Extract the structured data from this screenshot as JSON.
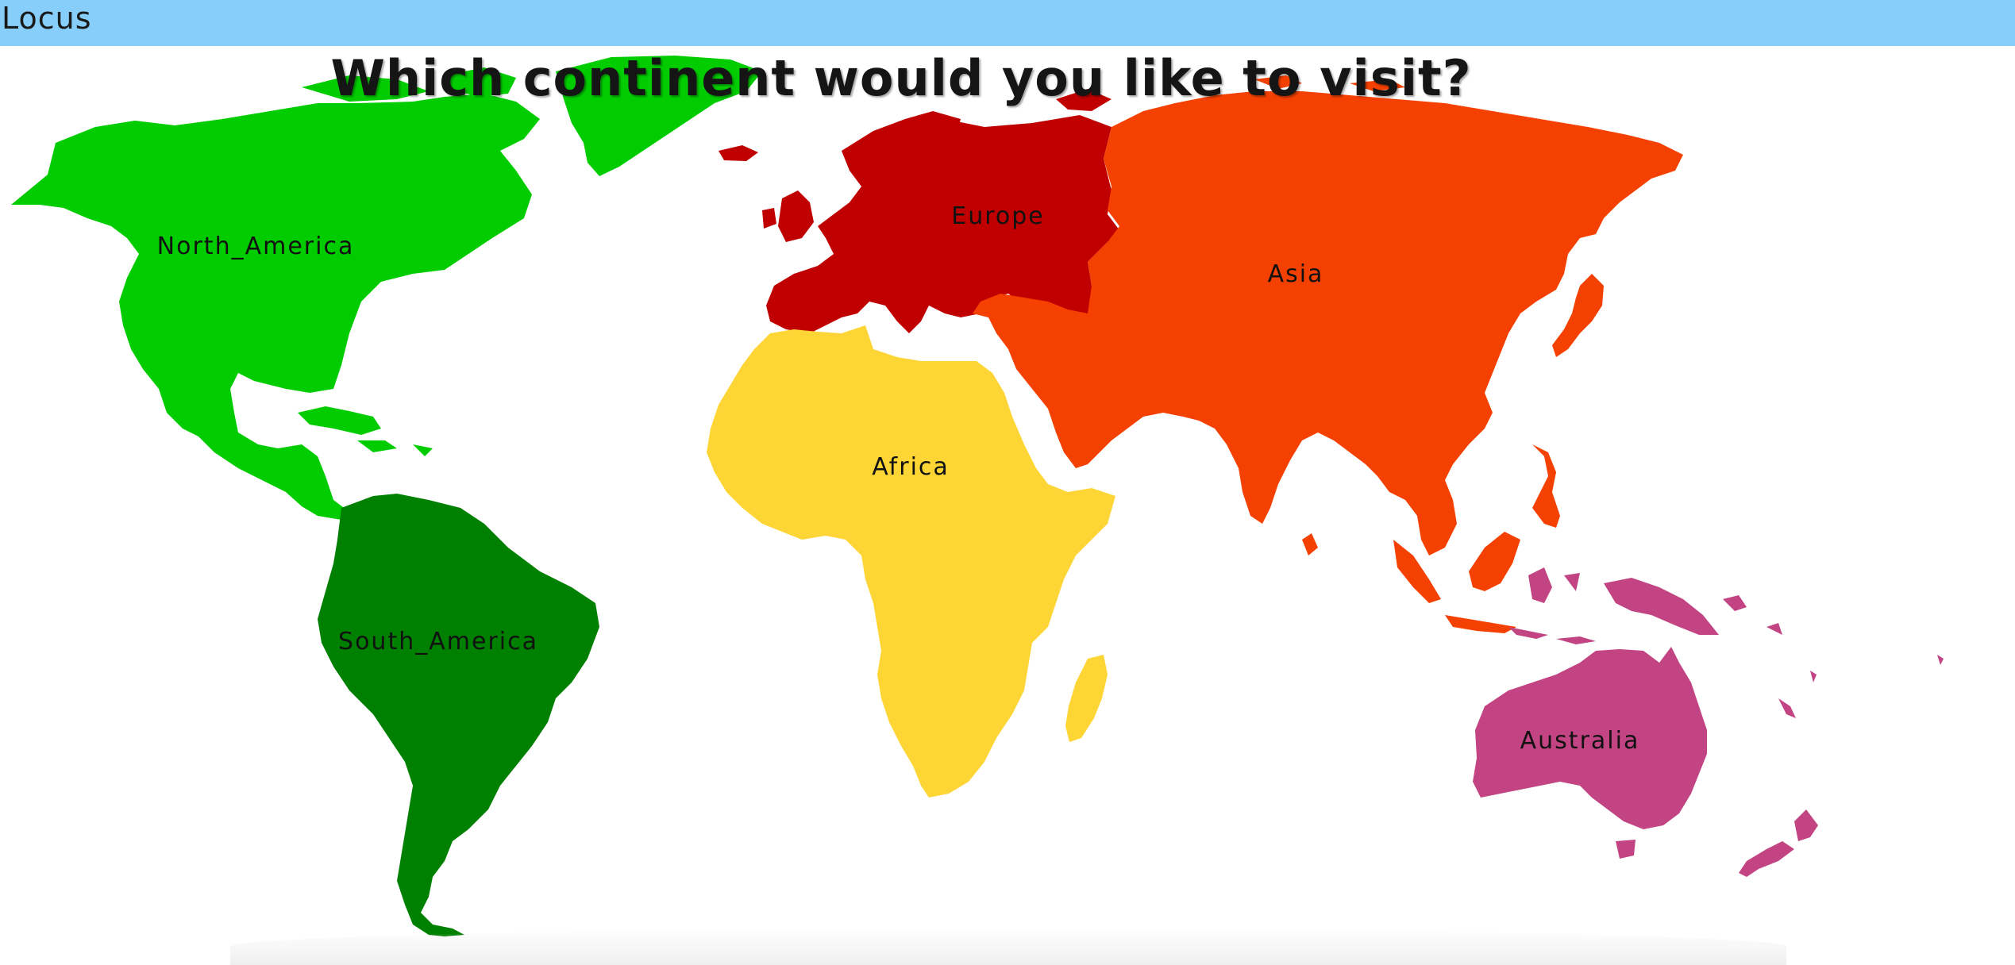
{
  "window": {
    "title": "Locus"
  },
  "prompt": {
    "question": "Which continent would you like to visit?"
  },
  "continents": [
    {
      "name": "North_America",
      "color": "#00cc00"
    },
    {
      "name": "South_America",
      "color": "#008000"
    },
    {
      "name": "Europe",
      "color": "#c00000"
    },
    {
      "name": "Asia",
      "color": "#f44000"
    },
    {
      "name": "Africa",
      "color": "#fdd535"
    },
    {
      "name": "Australia",
      "color": "#c24483"
    }
  ],
  "colors": {
    "titlebar": "#87cefa",
    "background": "#ffffff"
  }
}
